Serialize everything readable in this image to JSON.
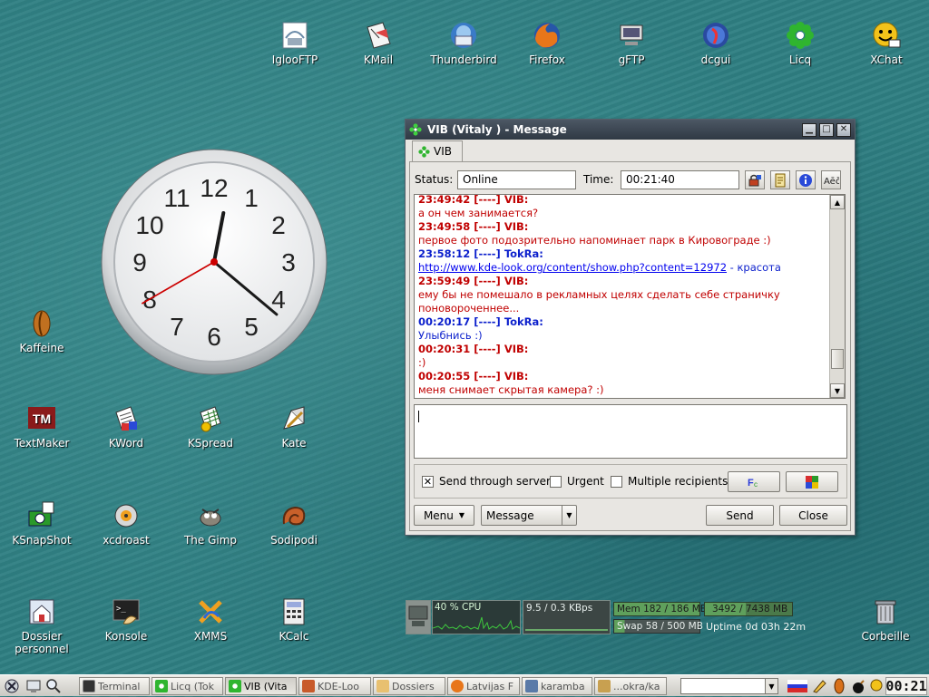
{
  "desktop": {
    "top_icons": [
      {
        "label": "IglooFTP",
        "icon": "igloo-ftp-icon"
      },
      {
        "label": "KMail",
        "icon": "kmail-icon"
      },
      {
        "label": "Thunderbird",
        "icon": "thunderbird-icon"
      },
      {
        "label": "Firefox",
        "icon": "firefox-icon"
      },
      {
        "label": "gFTP",
        "icon": "gftp-icon"
      },
      {
        "label": "dcgui",
        "icon": "dcgui-icon"
      },
      {
        "label": "Licq",
        "icon": "licq-icon"
      },
      {
        "label": "XChat",
        "icon": "xchat-icon"
      }
    ],
    "left_icons": [
      {
        "label": "Kaffeine",
        "icon": "kaffeine-icon"
      },
      {
        "label": "TextMaker",
        "icon": "textmaker-icon"
      },
      {
        "label": "KWord",
        "icon": "kword-icon"
      },
      {
        "label": "KSpread",
        "icon": "kspread-icon"
      },
      {
        "label": "Kate",
        "icon": "kate-icon"
      },
      {
        "label": "KSnapShot",
        "icon": "ksnapshot-icon"
      },
      {
        "label": "xcdroast",
        "icon": "xcdroast-icon"
      },
      {
        "label": "The Gimp",
        "icon": "gimp-icon"
      },
      {
        "label": "Sodipodi",
        "icon": "sodipodi-icon"
      },
      {
        "label": "Dossier\npersonnel",
        "icon": "home-folder-icon"
      },
      {
        "label": "Konsole",
        "icon": "konsole-icon"
      },
      {
        "label": "XMMS",
        "icon": "xmms-icon"
      },
      {
        "label": "KCalc",
        "icon": "kcalc-icon"
      },
      {
        "label": "Corbeille",
        "icon": "trash-icon"
      }
    ],
    "clock": {
      "numbers": [
        "12",
        "1",
        "2",
        "3",
        "4",
        "5",
        "6",
        "7",
        "8",
        "9",
        "10",
        "11"
      ],
      "hour": 0,
      "minute": 21,
      "second": 40
    }
  },
  "window": {
    "title": "VIB (Vitaly ) - Message",
    "tab_label": "VIB",
    "status_label": "Status:",
    "status_value": "Online",
    "time_label": "Time:",
    "time_value": "00:21:40",
    "messages": [
      {
        "header": "23:49:42 [----] VIB:",
        "sender": "vib",
        "text": "а он чем занимается?"
      },
      {
        "header": "23:49:58 [----] VIB:",
        "sender": "vib",
        "text": "первое фото подозрительно напоминает парк в Кировограде :)"
      },
      {
        "header": "23:58:12 [----] TokRa:",
        "sender": "tok",
        "link": "http://www.kde-look.org/content/show.php?content=12972",
        "text": " - красота"
      },
      {
        "header": "23:59:49 [----] VIB:",
        "sender": "vib",
        "text": "ему бы не помешало в рекламных целях сделать себе страничку поновороченнее..."
      },
      {
        "header": "00:20:17 [----] TokRa:",
        "sender": "tok",
        "text": "Улыбнись :)"
      },
      {
        "header": "00:20:31 [----] VIB:",
        "sender": "vib",
        "text": ":)"
      },
      {
        "header": "00:20:55 [----] VIB:",
        "sender": "vib",
        "text": "меня снимает скрытая камера? :)"
      }
    ],
    "options": {
      "send_through_server": "Send through server",
      "urgent": "Urgent",
      "multiple_recipients": "Multiple recipients"
    },
    "buttons": {
      "menu": "Menu",
      "message_type": "Message",
      "send": "Send",
      "close": "Close"
    }
  },
  "monitor": {
    "cpu": "40 % CPU",
    "net": "9.5 / 0.3 KBps",
    "mem": "Mem 182 / 186 MB",
    "swap": "Swap 58 / 500 MB",
    "disk": "3492 / 7438 MB",
    "uptime": "Uptime 0d 03h 22m"
  },
  "taskbar": {
    "tasks": [
      "Terminal",
      "Licq (Tok",
      "VIB (Vita",
      "KDE-Loo",
      "Dossiers",
      "Latvijas F",
      "karamba",
      "...okra/ka"
    ],
    "clock": "00:21"
  },
  "colors": {
    "vib": "#c00000",
    "tokra": "#0b1fcc",
    "titlebar": "#3a4550"
  }
}
